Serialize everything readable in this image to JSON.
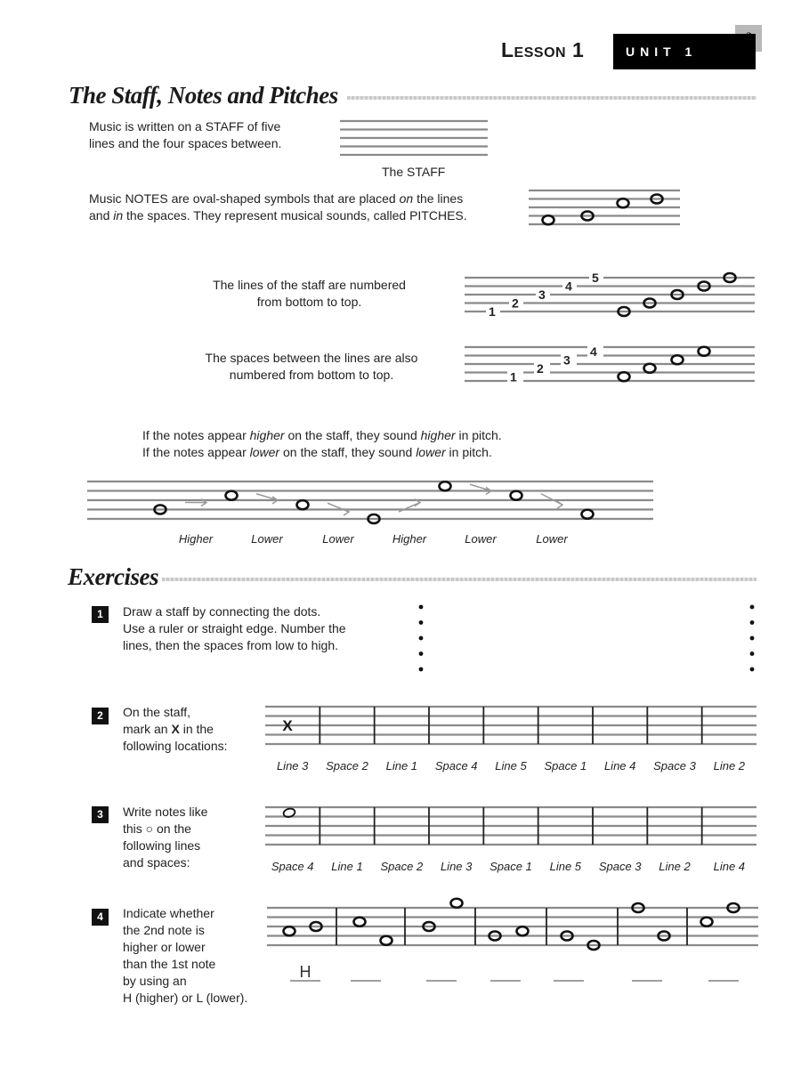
{
  "header": {
    "lesson": "Lesson 1",
    "unit": "UNIT 1",
    "page_number": "3"
  },
  "section1": {
    "title": "The Staff, Notes and Pitches",
    "staff_intro": [
      "Music is written on a STAFF of five",
      "lines and the four spaces between."
    ],
    "staff_caption": "The STAFF",
    "notes_intro_line1": "Music NOTES are oval-shaped symbols that are placed on the lines",
    "notes_intro_line2": "and in the spaces.  They represent musical sounds, called PITCHES.",
    "lines_numbered": [
      "The lines of the staff are numbered",
      "from bottom to top."
    ],
    "line_numbers": [
      "1",
      "2",
      "3",
      "4",
      "5"
    ],
    "spaces_numbered": [
      "The spaces between the lines are also",
      "numbered from bottom to top."
    ],
    "space_numbers": [
      "1",
      "2",
      "3",
      "4"
    ],
    "pitch_rule_1": "If the notes appear higher on the staff, they sound higher in pitch.",
    "pitch_rule_2": "If the notes appear lower on the staff, they sound lower in pitch.",
    "direction_labels": [
      "Higher",
      "Lower",
      "Lower",
      "Higher",
      "Lower",
      "Lower"
    ]
  },
  "section2": {
    "title": "Exercises",
    "exercises": [
      {
        "number": "1",
        "lines": [
          "Draw a staff by connecting the dots.",
          "Use a ruler or straight edge.  Number the",
          "lines, then the spaces from low to high."
        ]
      },
      {
        "number": "2",
        "lines": [
          "On the staff,",
          "mark an X in the",
          "following locations:"
        ],
        "example_mark": "X",
        "locations": [
          "Line 3",
          "Space 2",
          "Line 1",
          "Space 4",
          "Line 5",
          "Space 1",
          "Line 4",
          "Space 3",
          "Line 2"
        ]
      },
      {
        "number": "3",
        "lines": [
          "Write notes like",
          "this ○ on the",
          "following lines",
          "and spaces:"
        ],
        "locations": [
          "Space 4",
          "Line 1",
          "Space 2",
          "Line 3",
          "Space 1",
          "Line 5",
          "Space 3",
          "Line 2",
          "Line 4"
        ]
      },
      {
        "number": "4",
        "lines": [
          "Indicate whether",
          "the 2nd note is",
          "higher or lower",
          "than the 1st note",
          "by using an",
          "H (higher) or L (lower)."
        ],
        "answers": [
          "H",
          "",
          "",
          "",
          "",
          "",
          ""
        ]
      }
    ]
  }
}
